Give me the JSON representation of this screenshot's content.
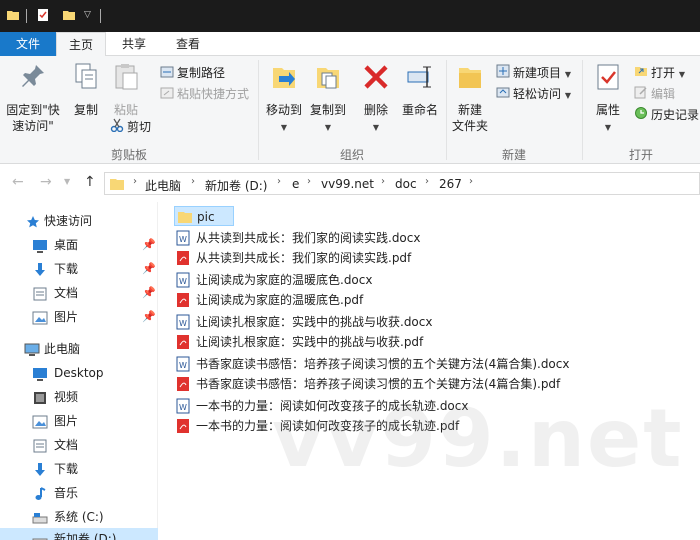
{
  "ribbon_tabs": {
    "file": "文件",
    "home": "主页",
    "share": "共享",
    "view": "查看"
  },
  "ribbon": {
    "clipboard": {
      "pin_quick_line1": "固定到\"快",
      "pin_quick_line2": "速访问\"",
      "copy": "复制",
      "paste": "粘贴",
      "copy_path": "复制路径",
      "paste_shortcut": "粘贴快捷方式",
      "cut": "剪切",
      "label": "剪贴板"
    },
    "organize": {
      "move_to": "移动到",
      "copy_to": "复制到",
      "delete": "删除",
      "rename": "重命名",
      "label": "组织"
    },
    "new": {
      "new_folder_line1": "新建",
      "new_folder_line2": "文件夹",
      "new_item": "新建项目",
      "easy_access": "轻松访问",
      "label": "新建"
    },
    "open": {
      "properties": "属性",
      "open": "打开",
      "edit": "编辑",
      "history": "历史记录",
      "label": "打开"
    }
  },
  "address": {
    "crumbs": [
      "此电脑",
      "新加卷 (D:)",
      "e",
      "vv99.net",
      "doc",
      "267"
    ]
  },
  "nav": {
    "quick_access": "快速访问",
    "desktop": "桌面",
    "downloads": "下载",
    "documents": "文档",
    "pictures": "图片",
    "this_pc": "此电脑",
    "pc_desktop": "Desktop",
    "videos": "视频",
    "pc_pictures": "图片",
    "pc_documents": "文档",
    "pc_downloads": "下载",
    "music": "音乐",
    "system_c": "系统 (C:)",
    "new_volume_d": "新加卷 (D:)"
  },
  "files": [
    {
      "name": "pic",
      "type": "folder"
    },
    {
      "name": "从共读到共成长：我们家的阅读实践.docx",
      "type": "docx"
    },
    {
      "name": "从共读到共成长：我们家的阅读实践.pdf",
      "type": "pdf"
    },
    {
      "name": "让阅读成为家庭的温暖底色.docx",
      "type": "docx"
    },
    {
      "name": "让阅读成为家庭的温暖底色.pdf",
      "type": "pdf"
    },
    {
      "name": "让阅读扎根家庭：实践中的挑战与收获.docx",
      "type": "docx"
    },
    {
      "name": "让阅读扎根家庭：实践中的挑战与收获.pdf",
      "type": "pdf"
    },
    {
      "name": "书香家庭读书感悟：培养孩子阅读习惯的五个关键方法(4篇合集).docx",
      "type": "docx"
    },
    {
      "name": "书香家庭读书感悟：培养孩子阅读习惯的五个关键方法(4篇合集).pdf",
      "type": "pdf"
    },
    {
      "name": "一本书的力量：阅读如何改变孩子的成长轨迹.docx",
      "type": "docx"
    },
    {
      "name": "一本书的力量：阅读如何改变孩子的成长轨迹.pdf",
      "type": "pdf"
    }
  ],
  "watermark": "vv99.net",
  "colors": {
    "accent": "#1979ca",
    "selection": "#cce8ff",
    "folder": "#f8d775",
    "pdf_red": "#e0322e",
    "word_blue": "#2b5797",
    "delete_red": "#d92a2a"
  }
}
